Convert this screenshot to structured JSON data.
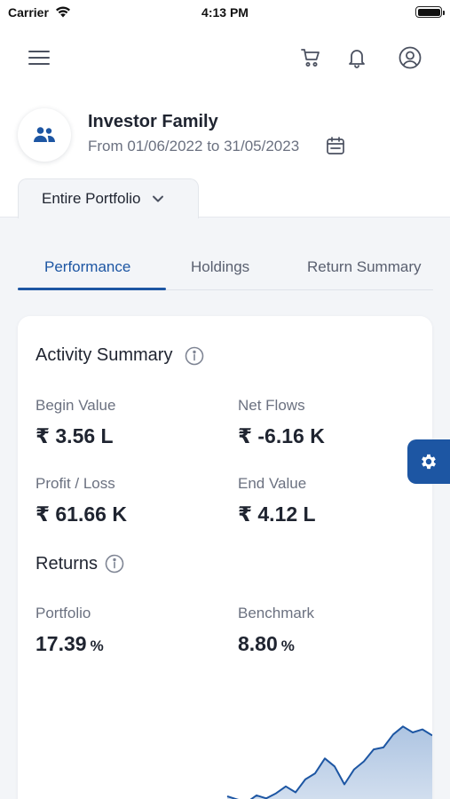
{
  "status_bar": {
    "carrier": "Carrier",
    "time": "4:13 PM"
  },
  "header": {
    "icons": [
      "menu-icon",
      "cart-icon",
      "bell-icon",
      "user-icon"
    ]
  },
  "investor": {
    "name": "Investor Family",
    "date_range": "From 01/06/2022 to 31/05/2023"
  },
  "portfolio_selector": {
    "value": "Entire Portfolio"
  },
  "tabs": [
    {
      "label": "Performance",
      "active": true
    },
    {
      "label": "Holdings",
      "active": false
    },
    {
      "label": "Return Summary",
      "active": false
    }
  ],
  "activity_summary": {
    "title": "Activity Summary",
    "items": [
      {
        "label": "Begin Value",
        "value": "₹ 3.56 L"
      },
      {
        "label": "Net Flows",
        "value": "₹ -6.16 K"
      },
      {
        "label": "Profit / Loss",
        "value": "₹ 61.66 K"
      },
      {
        "label": "End Value",
        "value": "₹ 4.12 L"
      }
    ]
  },
  "returns": {
    "title": "Returns",
    "items": [
      {
        "label": "Portfolio",
        "value": "17.39",
        "unit": "%"
      },
      {
        "label": "Benchmark",
        "value": "8.80",
        "unit": "%"
      }
    ]
  },
  "colors": {
    "accent": "#1d56a3",
    "chart_fill": "#a9c1e0",
    "chart_line": "#1d56a3"
  },
  "chart_data": {
    "type": "area",
    "series": [
      {
        "values": [
          0.08,
          0.05,
          0.02,
          0.09,
          0.06,
          0.11,
          0.18,
          0.12,
          0.25,
          0.31,
          0.46,
          0.38,
          0.2,
          0.35,
          0.43,
          0.55,
          0.57,
          0.7,
          0.78,
          0.72,
          0.75,
          0.69
        ]
      }
    ]
  }
}
